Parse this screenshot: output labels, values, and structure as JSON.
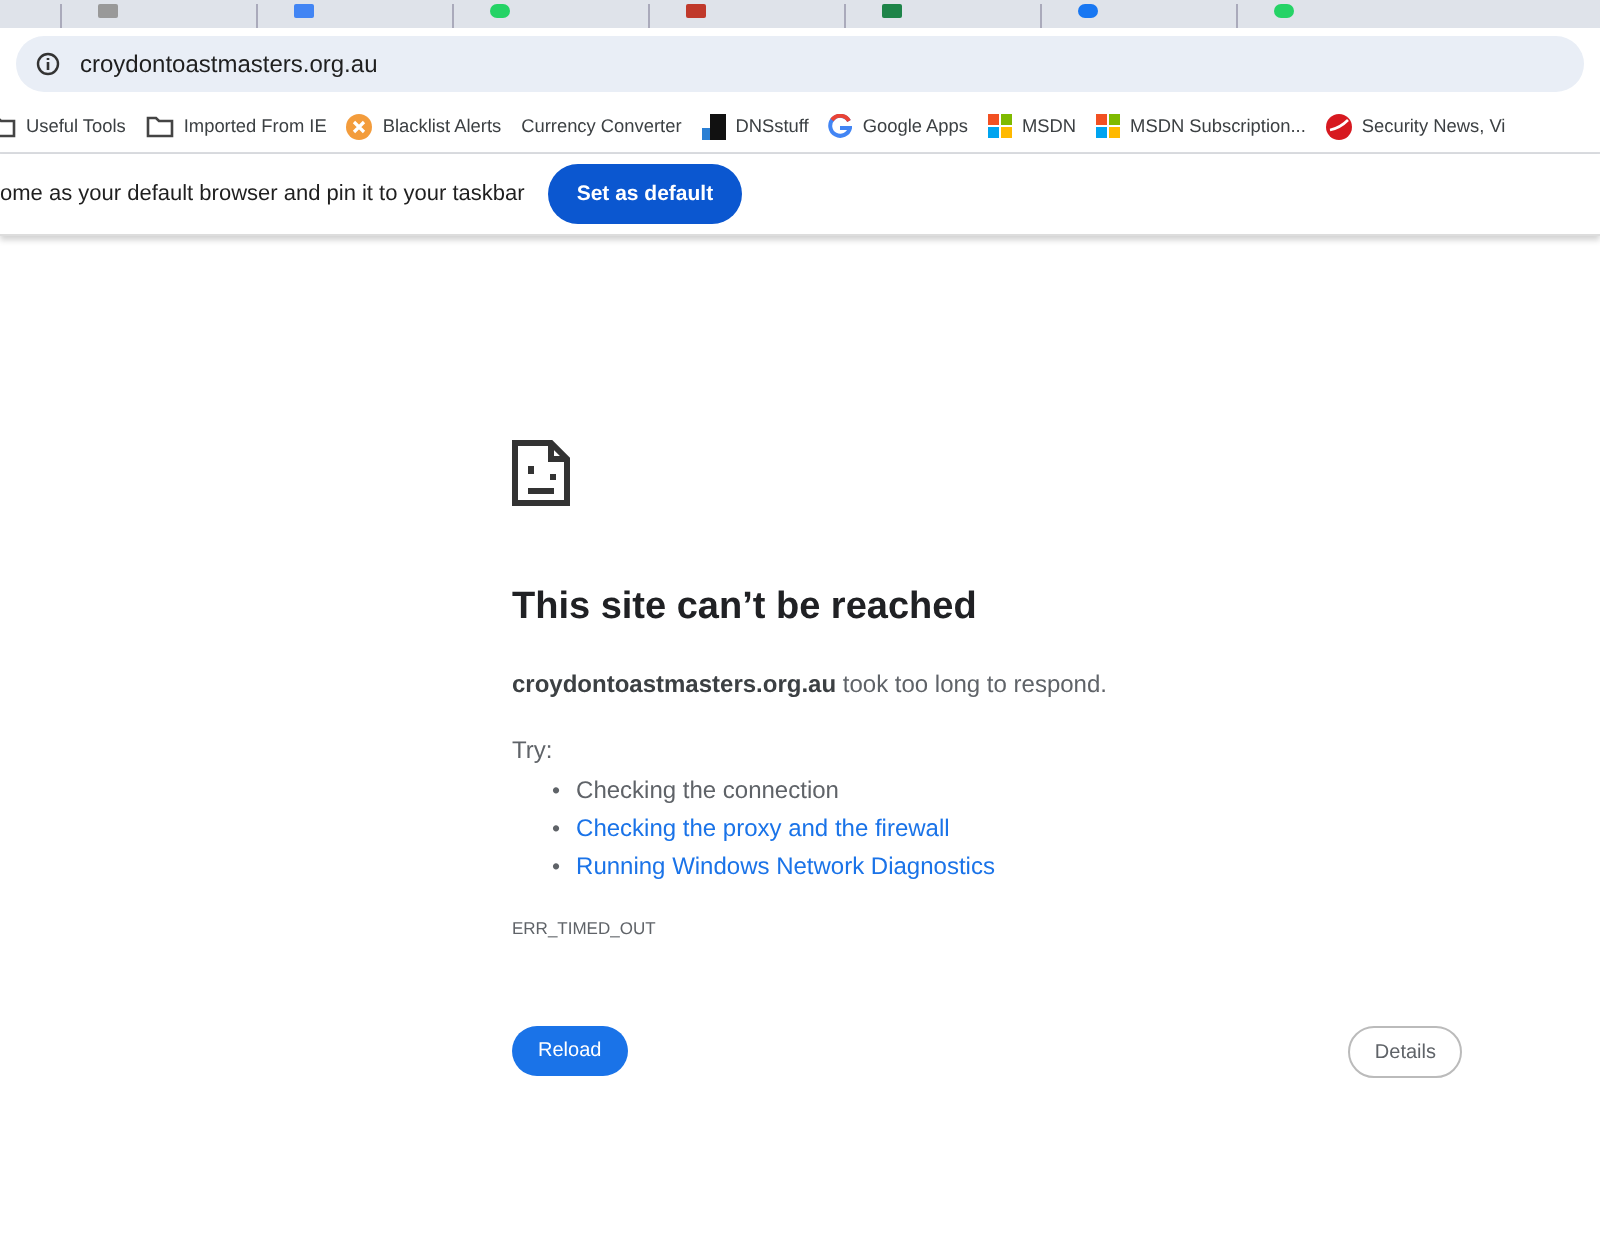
{
  "tabs": [
    {
      "kind": "generic"
    },
    {
      "kind": "calendar"
    },
    {
      "kind": "chat"
    },
    {
      "kind": "grid"
    },
    {
      "kind": "square"
    },
    {
      "kind": "circle"
    },
    {
      "kind": "chat"
    }
  ],
  "address_bar": {
    "url": "croydontoastmasters.org.au"
  },
  "bookmarks": [
    {
      "kind": "folder",
      "label": "Useful Tools"
    },
    {
      "kind": "folder",
      "label": "Imported From IE"
    },
    {
      "kind": "alert",
      "label": "Blacklist Alerts"
    },
    {
      "kind": "plain",
      "label": "Currency Converter"
    },
    {
      "kind": "dns",
      "label": "DNSstuff"
    },
    {
      "kind": "google",
      "label": "Google Apps"
    },
    {
      "kind": "windows",
      "label": "MSDN"
    },
    {
      "kind": "windows",
      "label": "MSDN Subscription..."
    },
    {
      "kind": "security",
      "label": "Security News, Vi"
    }
  ],
  "infobar": {
    "message": "ome as your default browser and pin it to your taskbar",
    "button": "Set as default"
  },
  "error": {
    "title": "This site can’t be reached",
    "host": "croydontoastmasters.org.au",
    "message": " took too long to respond.",
    "try_label": "Try:",
    "bullet": "•",
    "suggestions": [
      {
        "text": "Checking the connection",
        "link": false
      },
      {
        "text": "Checking the proxy and the firewall",
        "link": true
      },
      {
        "text": "Running Windows Network Diagnostics",
        "link": true
      }
    ],
    "code": "ERR_TIMED_OUT",
    "reload": "Reload",
    "details": "Details"
  }
}
